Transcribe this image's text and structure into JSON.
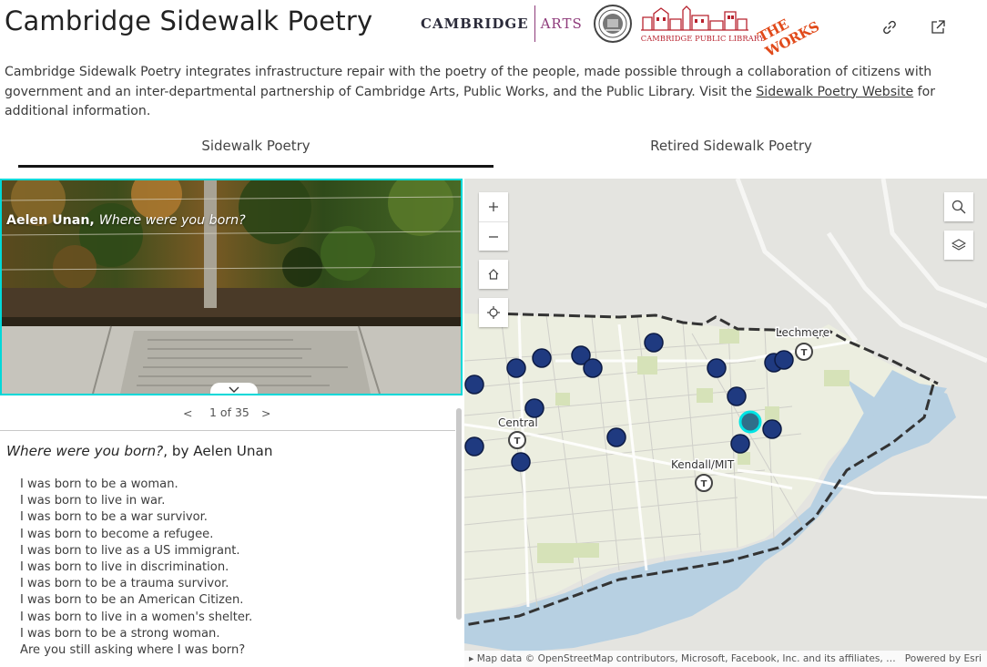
{
  "header": {
    "title": "Cambridge Sidewalk Poetry",
    "logos": {
      "cambridge": "CAMBRIDGE",
      "arts": "ARTS",
      "library_caption": "CAMBRIDGE PUBLIC LIBRARY",
      "works": "THE WORKS"
    },
    "buttons": {
      "link_icon": "link-icon",
      "share_icon": "share-icon"
    }
  },
  "intro": {
    "text_before": "Cambridge Sidewalk Poetry integrates infrastructure repair with the poetry of the people, made possible through a collaboration of citizens with government and an inter-departmental partnership of Cambridge Arts, Public Works, and the Public Library. Visit the ",
    "link": "Sidewalk Poetry Website",
    "text_after": " for additional information."
  },
  "tabs": [
    {
      "label": "Sidewalk Poetry",
      "active": true
    },
    {
      "label": "Retired Sidewalk Poetry",
      "active": false
    }
  ],
  "feature": {
    "author": "Aelen Unan,",
    "title_italic": "Where were you born?",
    "pager": {
      "prev": "<",
      "count": "1 of 35",
      "next": ">"
    },
    "poem_title": "Where were you born?",
    "poem_byline": ", by Aelen Unan",
    "lines": [
      "I was born to be a woman.",
      "I was born to live in war.",
      "I was born to be a war survivor.",
      "I was born to become a refugee.",
      "I was born to live as a US immigrant.",
      "I was born to live in discrimination.",
      "I was born to be a trauma survivor.",
      "I was born to be an American Citizen.",
      "I was born to live in a women's shelter.",
      "I was born to be a strong woman.",
      "Are you still asking where I was born?"
    ]
  },
  "map": {
    "labels": {
      "central": "Central",
      "kendall": "Kendall/MIT",
      "lechmere": "Lechmere"
    },
    "controls": [
      "zoom-in",
      "zoom-out",
      "home",
      "locate",
      "search",
      "layers"
    ],
    "attribution": "Map data © OpenStreetMap contributors, Microsoft, Facebook, Inc. and its affiliates, …",
    "powered_by": "Powered by Esri",
    "colors": {
      "poem_point": "#1f3a80",
      "selected_outline": "#00e5e5",
      "water": "#aecbe0",
      "land": "#eeeee6"
    }
  }
}
